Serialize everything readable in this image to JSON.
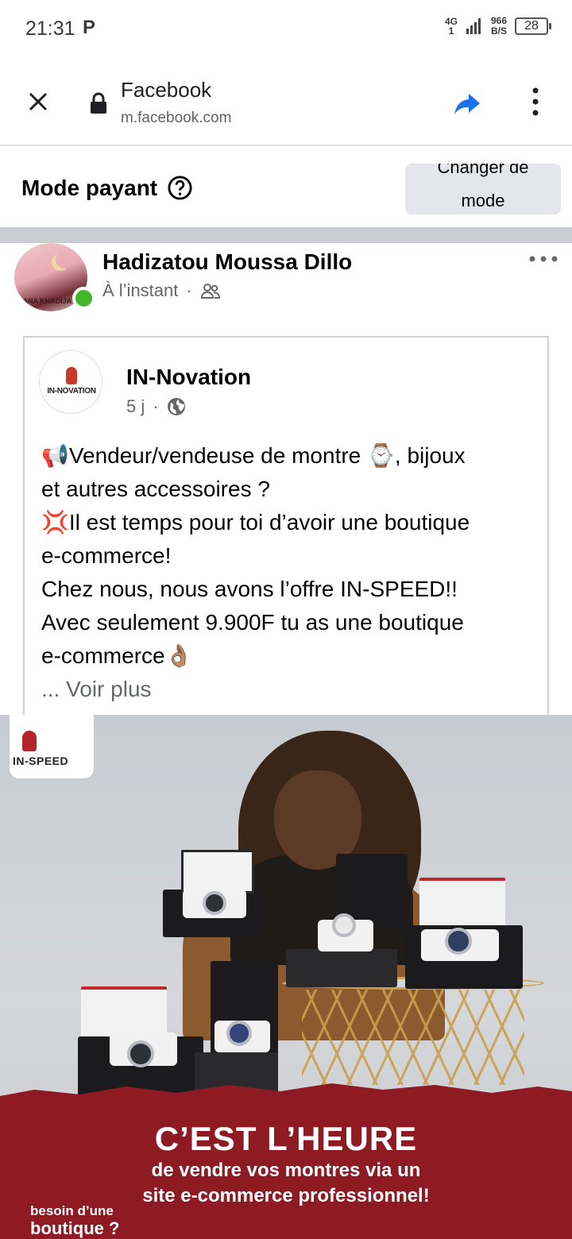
{
  "status_bar": {
    "time": "21:31",
    "p_icon": "P",
    "network": "4G",
    "network_sub": "1",
    "speed_value": "966",
    "speed_unit": "B/S",
    "battery": "28"
  },
  "browser": {
    "title": "Facebook",
    "url": "m.facebook.com",
    "icons": [
      "close-icon",
      "lock-icon",
      "share-icon",
      "more-vertical-icon"
    ]
  },
  "mode_bar": {
    "label": "Mode payant",
    "button_label": "Changer de mode"
  },
  "post": {
    "author": "Hadizatou Moussa Dillo",
    "avatar_text": "NANA KHADIJA",
    "time": "À l’instant",
    "separator": "·"
  },
  "shared": {
    "page_name": "IN-Novation",
    "avatar_text": "IN-NOVATION",
    "time": "5 j",
    "separator": "·",
    "lines": [
      "📢Vendeur/vendeuse de montre ⌚, bijoux",
      "et autres accessoires ?",
      "💢Il est temps pour toi d’avoir une boutique",
      "e-commerce!",
      "Chez nous, nous avons l’offre IN-SPEED!!",
      "Avec seulement 9.900F tu as une boutique",
      "e-commerce👌🏽"
    ],
    "see_more": "... Voir plus"
  },
  "ad": {
    "logo_text": "IN-SPEED",
    "headline": "C’EST L’HEURE",
    "subline_1": "de vendre vos montres via un",
    "subline_2": "site e-commerce professionnel!",
    "corner_1": "besoin d’une",
    "corner_2": "boutique ?"
  },
  "colors": {
    "accent_blue": "#1877f2",
    "online_green": "#42b72a",
    "ad_red": "#8e1b24",
    "muted_text": "#65676b"
  }
}
